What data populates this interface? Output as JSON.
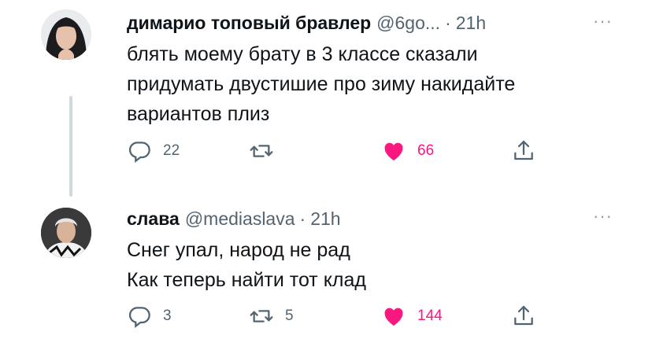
{
  "tweets": [
    {
      "display_name": "димарио топовый бравлер",
      "handle": "@6go...",
      "separator": "·",
      "time": "21h",
      "more": "···",
      "lines": [
        "блять моему брату в 3 классе сказали",
        "придумать двустишие про зиму накидайте",
        "вариантов плиз"
      ],
      "replies": "22",
      "retweets": "",
      "likes": "66",
      "liked": true
    },
    {
      "display_name": "слава",
      "handle": "@mediaslava",
      "separator": "·",
      "time": "21h",
      "more": "···",
      "lines": [
        "Снег упал, народ не рад",
        "Как теперь найти тот клад"
      ],
      "replies": "3",
      "retweets": "5",
      "likes": "144",
      "liked": true
    }
  ],
  "icons": {
    "reply": "reply-icon",
    "retweet": "retweet-icon",
    "like": "heart-icon",
    "share": "share-icon"
  },
  "colors": {
    "like_active": "#f91880",
    "secondary_text": "#536471",
    "thread_line": "#cfd9de"
  }
}
